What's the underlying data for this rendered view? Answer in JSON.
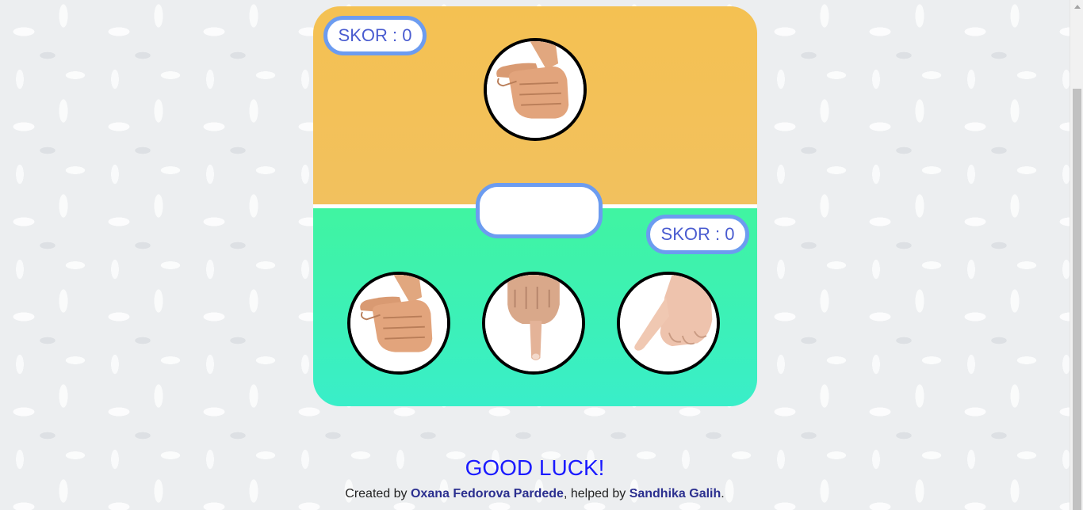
{
  "computer": {
    "score_label": "SKOR : 0",
    "hand_icon": "rock-hand-icon"
  },
  "player": {
    "score_label": "SKOR : 0",
    "choices": [
      {
        "id": "rock",
        "icon": "rock-hand-icon"
      },
      {
        "id": "paper",
        "icon": "pointing-down-hand-icon"
      },
      {
        "id": "scissors",
        "icon": "pointing-finger-hand-icon"
      }
    ]
  },
  "result": {
    "text": ""
  },
  "footer": {
    "title": "GOOD LUCK!",
    "created_by_prefix": "Created by ",
    "author": "Oxana Fedorova Pardede",
    "helped_by_prefix": ", helped by ",
    "helper": "Sandhika Galih",
    "suffix": "."
  },
  "colors": {
    "computer_area": "#f4c152",
    "player_area": "#40f4a1",
    "accent_border": "#6c9cf0",
    "score_text": "#4a5cd0",
    "footer_title": "#1a1aff"
  }
}
